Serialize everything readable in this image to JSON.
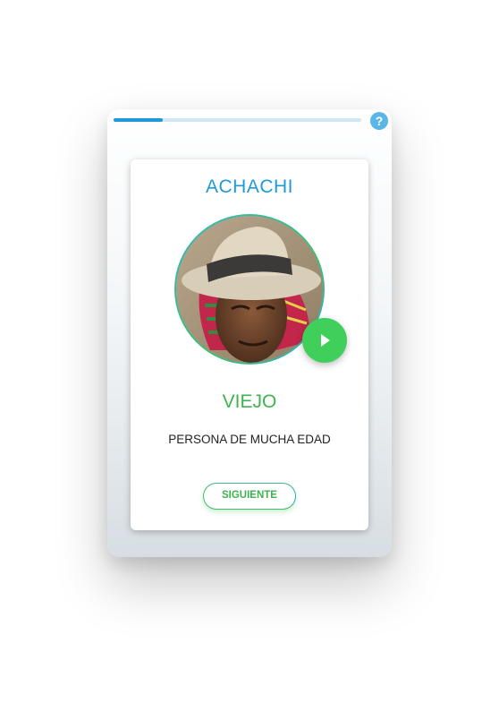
{
  "progress": {
    "fraction": 0.2
  },
  "help": {
    "label": "?"
  },
  "card": {
    "word": "ACHACHI",
    "translation": "VIEJO",
    "definition": "PERSONA DE MUCHA EDAD",
    "next_label": "SIGUIENTE"
  },
  "icons": {
    "help": "question-mark-icon",
    "play": "play-icon"
  },
  "colors": {
    "accent_blue": "#1e9bd7",
    "accent_green": "#3fb34f",
    "play_green": "#3fcf5a",
    "progress_track": "#cfe6f3"
  }
}
